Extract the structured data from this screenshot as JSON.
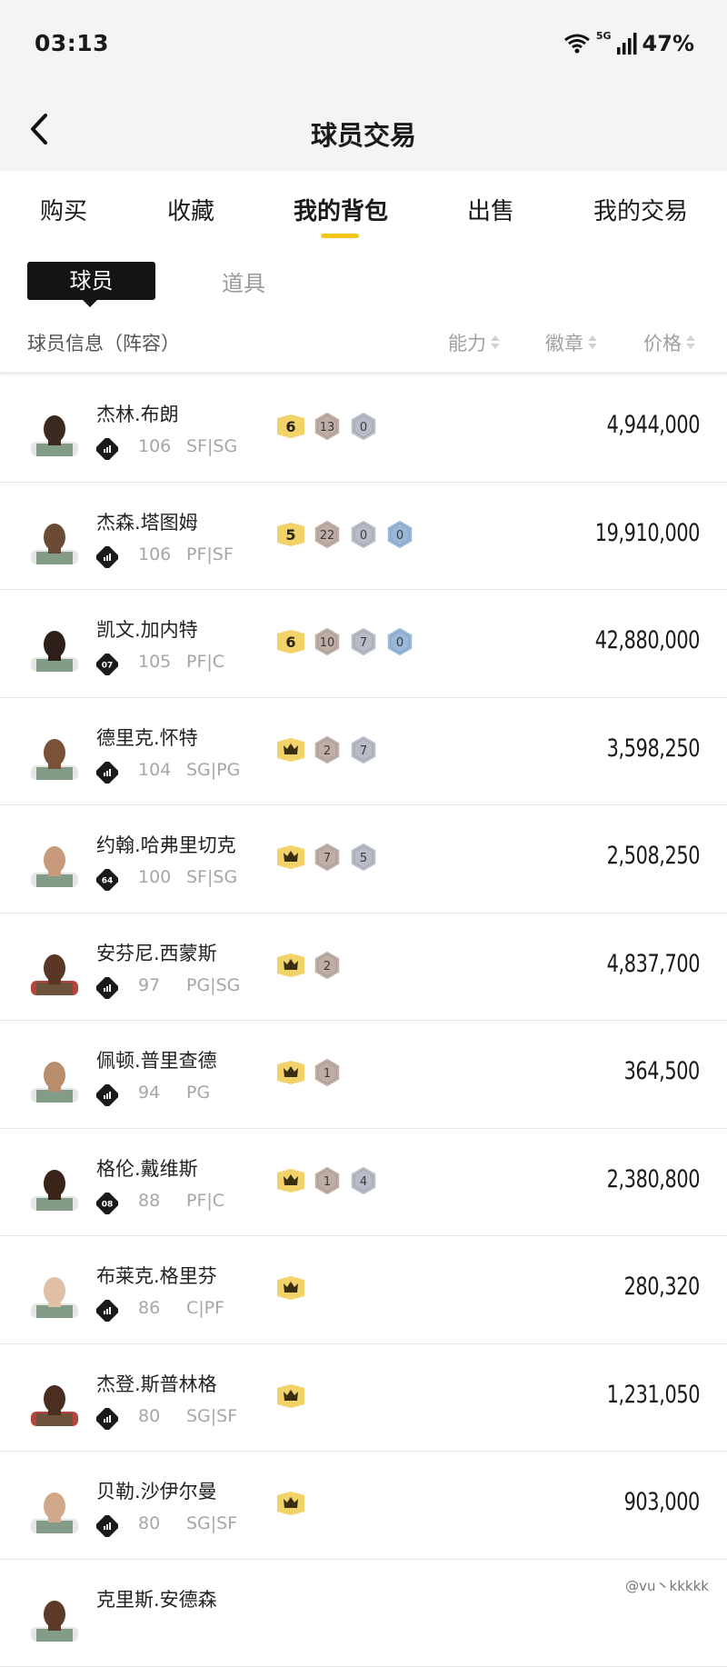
{
  "status": {
    "time": "03:13",
    "network": "5G",
    "battery": "47%"
  },
  "nav": {
    "title": "球员交易"
  },
  "tabs": [
    {
      "label": "购买"
    },
    {
      "label": "收藏"
    },
    {
      "label": "我的背包"
    },
    {
      "label": "出售"
    },
    {
      "label": "我的交易"
    }
  ],
  "segment": {
    "active": "球员",
    "inactive": "道具"
  },
  "columns": {
    "info": "球员信息（阵容）",
    "ability": "能力",
    "badges": "徽章",
    "price": "价格"
  },
  "colors": {
    "accent": "#f5c518",
    "gold": "#f2d36a",
    "bronze": "#bfaea6",
    "silver": "#b8bcc7",
    "blue": "#9ab8d9"
  },
  "players": [
    {
      "name": "杰林.布朗",
      "tier_icon": "tier-bars-icon",
      "rating": "106",
      "position": "SF|SG",
      "badges": [
        {
          "type": "gold",
          "label": "6"
        },
        {
          "type": "bronze",
          "label": "13"
        },
        {
          "type": "silver",
          "label": "0"
        }
      ],
      "price": "4,944,000"
    },
    {
      "name": "杰森.塔图姆",
      "tier_icon": "tier-bars-icon",
      "rating": "106",
      "position": "PF|SF",
      "badges": [
        {
          "type": "gold",
          "label": "5"
        },
        {
          "type": "bronze",
          "label": "22"
        },
        {
          "type": "silver",
          "label": "0"
        },
        {
          "type": "blue",
          "label": "0"
        }
      ],
      "price": "19,910,000"
    },
    {
      "name": "凯文.加内特",
      "tier_icon": "07",
      "rating": "105",
      "position": "PF|C",
      "badges": [
        {
          "type": "gold",
          "label": "6"
        },
        {
          "type": "bronze",
          "label": "10"
        },
        {
          "type": "silver",
          "label": "7"
        },
        {
          "type": "blue",
          "label": "0"
        }
      ],
      "price": "42,880,000"
    },
    {
      "name": "德里克.怀特",
      "tier_icon": "tier-bars-icon",
      "rating": "104",
      "position": "SG|PG",
      "badges": [
        {
          "type": "crown",
          "label": ""
        },
        {
          "type": "bronze",
          "label": "2"
        },
        {
          "type": "silver",
          "label": "7"
        }
      ],
      "price": "3,598,250"
    },
    {
      "name": "约翰.哈弗里切克",
      "tier_icon": "64",
      "rating": "100",
      "position": "SF|SG",
      "badges": [
        {
          "type": "crown",
          "label": ""
        },
        {
          "type": "bronze",
          "label": "7"
        },
        {
          "type": "silver",
          "label": "5"
        }
      ],
      "price": "2,508,250"
    },
    {
      "name": "安芬尼.西蒙斯",
      "tier_icon": "tier-bars-icon",
      "rating": "97",
      "position": "PG|SG",
      "badges": [
        {
          "type": "crown",
          "label": ""
        },
        {
          "type": "bronze",
          "label": "2"
        }
      ],
      "price": "4,837,700"
    },
    {
      "name": "佩顿.普里查德",
      "tier_icon": "tier-bars-icon",
      "rating": "94",
      "position": "PG",
      "badges": [
        {
          "type": "crown",
          "label": ""
        },
        {
          "type": "bronze",
          "label": "1"
        }
      ],
      "price": "364,500"
    },
    {
      "name": "格伦.戴维斯",
      "tier_icon": "08",
      "rating": "88",
      "position": "PF|C",
      "badges": [
        {
          "type": "crown",
          "label": ""
        },
        {
          "type": "bronze",
          "label": "1"
        },
        {
          "type": "silver",
          "label": "4"
        }
      ],
      "price": "2,380,800"
    },
    {
      "name": "布莱克.格里芬",
      "tier_icon": "tier-bars-icon",
      "rating": "86",
      "position": "C|PF",
      "badges": [
        {
          "type": "crown",
          "label": ""
        }
      ],
      "price": "280,320"
    },
    {
      "name": "杰登.斯普林格",
      "tier_icon": "tier-bars-icon",
      "rating": "80",
      "position": "SG|SF",
      "badges": [
        {
          "type": "crown",
          "label": ""
        }
      ],
      "price": "1,231,050"
    },
    {
      "name": "贝勒.沙伊尔曼",
      "tier_icon": "tier-bars-icon",
      "rating": "80",
      "position": "SG|SF",
      "badges": [
        {
          "type": "crown",
          "label": ""
        }
      ],
      "price": "903,000"
    },
    {
      "name": "克里斯.安德森",
      "tier_icon": "tier-bars-icon",
      "rating": "",
      "position": "",
      "badges": [],
      "price": ""
    }
  ],
  "watermark": "@vu丶kkkkk"
}
